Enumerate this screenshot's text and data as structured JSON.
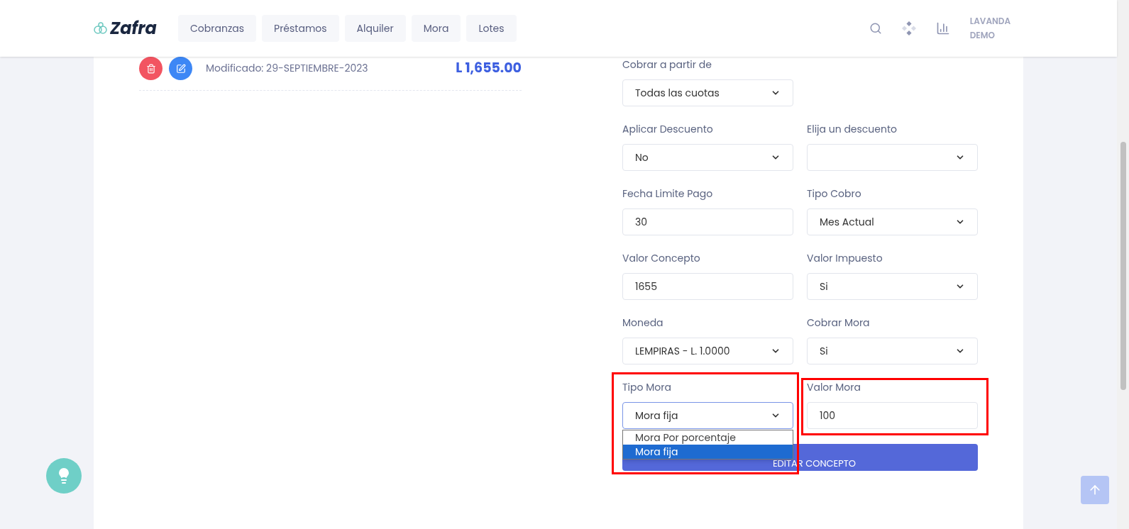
{
  "brand": "Zafra",
  "nav": [
    {
      "label": "Cobranzas",
      "selected": false
    },
    {
      "label": "Préstamos",
      "selected": false
    },
    {
      "label": "Alquiler",
      "selected": false
    },
    {
      "label": "Mora",
      "selected": false
    },
    {
      "label": "Lotes",
      "selected": false
    }
  ],
  "user": {
    "name": "LAVANDA",
    "company": "DEMO"
  },
  "concept": {
    "modified": "Modificado: 29-SEPTIEMBRE-2023",
    "amount": "L 1,655.00"
  },
  "form_rows": [
    [
      {
        "label": "Cobrar a partir de",
        "kind": "select",
        "value": "Todas las cuotas",
        "highlighted": false
      }
    ],
    [
      {
        "label": "Aplicar Descuento",
        "kind": "select",
        "value": "No",
        "highlighted": false
      },
      {
        "label": "Elija un descuento",
        "kind": "select",
        "highlighted": false
      }
    ],
    [
      {
        "label": "Fecha Limite Pago",
        "kind": "input",
        "value": "30",
        "highlighted": false
      },
      {
        "label": "Tipo Cobro",
        "kind": "select",
        "value": "Mes Actual",
        "highlighted": false
      }
    ],
    [
      {
        "label": "Valor Concepto",
        "kind": "input",
        "value": "1655",
        "highlighted": false
      },
      {
        "label": "Valor Impuesto",
        "kind": "select",
        "value": "Si",
        "highlighted": false
      }
    ],
    [
      {
        "label": "Moneda",
        "kind": "select",
        "value": "LEMPIRAS - L. 1.0000",
        "highlighted": false
      },
      {
        "label": "Cobrar Mora",
        "kind": "select",
        "value": "Si",
        "highlighted": false
      }
    ],
    [
      {
        "label": "Tipo Mora",
        "kind": "select",
        "value": "Mora fija",
        "highlighted": true,
        "open": true,
        "options": [
          {
            "label": "Mora Por porcentaje",
            "selected": false
          },
          {
            "label": "Mora fija",
            "selected": true
          }
        ]
      },
      {
        "label": "Valor Mora",
        "kind": "input",
        "value": "100",
        "highlighted": true
      }
    ]
  ],
  "submit": "EDITAR CONCEPTO"
}
